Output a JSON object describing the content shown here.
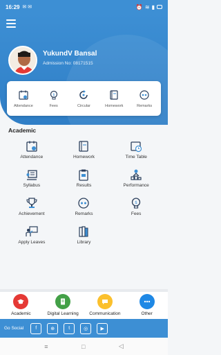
{
  "status_bar": {
    "time": "16:29"
  },
  "profile": {
    "name": "YukundV Bansal",
    "admission": "Admission No: 08171515"
  },
  "quick_links": [
    {
      "label": "Attendance",
      "icon": "calendar-check-icon"
    },
    {
      "label": "Fees",
      "icon": "money-bulb-icon"
    },
    {
      "label": "Circular",
      "icon": "circular-arrow-icon"
    },
    {
      "label": "Homework",
      "icon": "book-icon"
    },
    {
      "label": "Remarks",
      "icon": "chat-icon"
    }
  ],
  "section": {
    "title": "Academic"
  },
  "grid": [
    {
      "label": "Attendance",
      "icon": "calendar-check-icon"
    },
    {
      "label": "Homework",
      "icon": "book-icon"
    },
    {
      "label": "Time Table",
      "icon": "calendar-clock-icon"
    },
    {
      "label": "Syllabus",
      "icon": "syllabus-board-icon"
    },
    {
      "label": "Results",
      "icon": "results-clipboard-icon"
    },
    {
      "label": "Performance",
      "icon": "performance-podium-icon"
    },
    {
      "label": "Achievement",
      "icon": "trophy-icon"
    },
    {
      "label": "Remarks",
      "icon": "chat-icon"
    },
    {
      "label": "Fees",
      "icon": "money-bulb-icon"
    },
    {
      "label": "Apply Leaves",
      "icon": "teacher-board-icon"
    },
    {
      "label": "Library",
      "icon": "library-books-icon"
    }
  ],
  "bottom_nav": [
    {
      "label": "Academic",
      "icon": "graduation-cap-icon",
      "color": "#e53935"
    },
    {
      "label": "Digital Learning",
      "icon": "document-icon",
      "color": "#43a047"
    },
    {
      "label": "Communication",
      "icon": "chat-bubble-icon",
      "color": "#fbc02d"
    },
    {
      "label": "Other",
      "icon": "more-dots-icon",
      "color": "#1e88e5"
    }
  ],
  "social": {
    "label": "Go Social"
  },
  "colors": {
    "primary": "#3d8fd4",
    "icon": "#2b3f5c"
  }
}
